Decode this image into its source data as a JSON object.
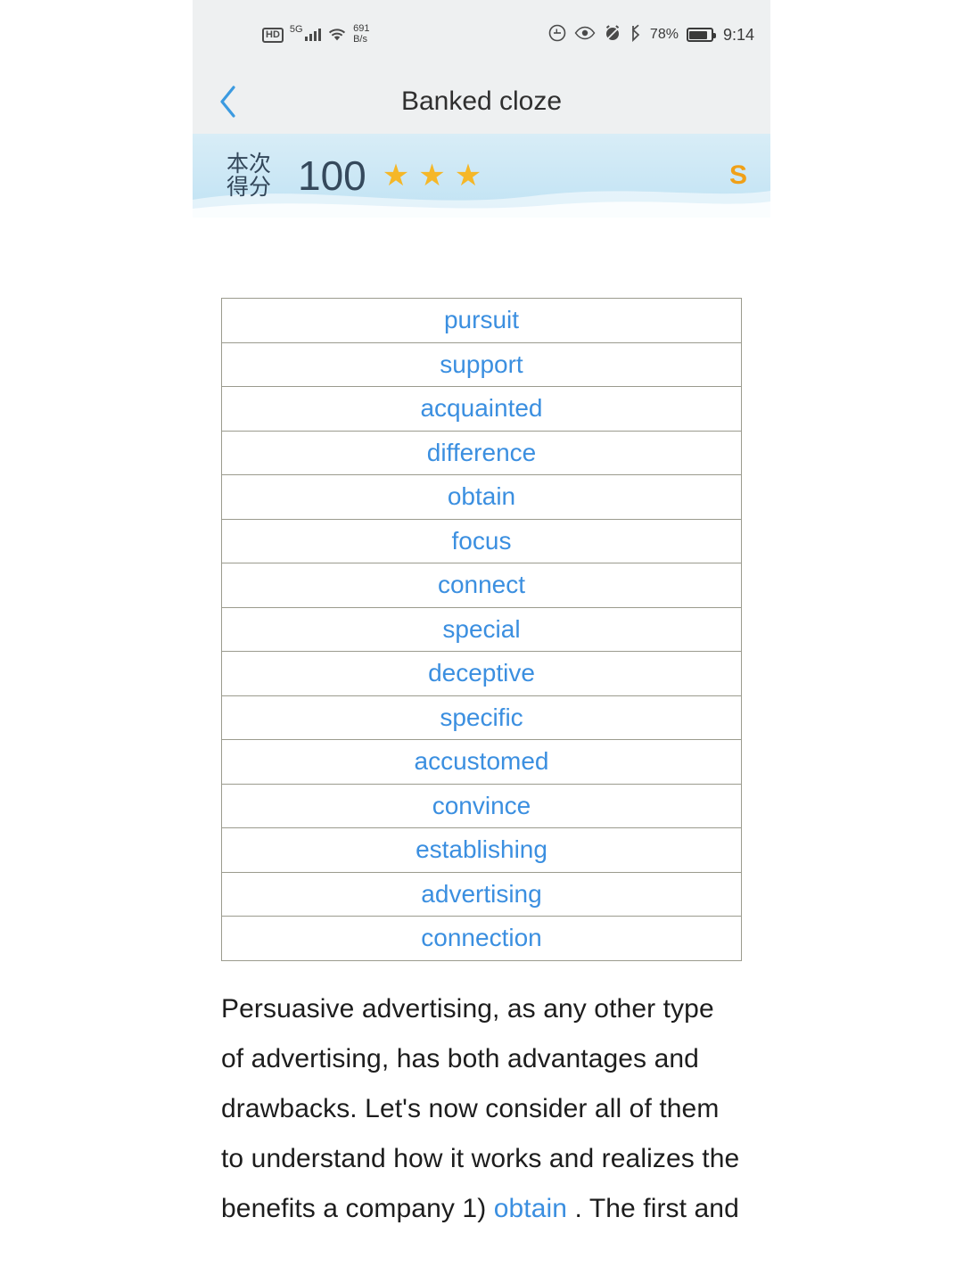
{
  "status_bar": {
    "hd_label": "HD",
    "network_type": "5G",
    "net_rate_value": "691",
    "net_rate_unit": "B/s",
    "battery_percent": "78%",
    "clock": "9:14",
    "icons": [
      "hd-icon",
      "signal-icon",
      "wifi-icon",
      "do-not-disturb-icon",
      "eye-care-icon",
      "alarm-mute-icon",
      "bluetooth-icon",
      "battery-icon"
    ]
  },
  "title_bar": {
    "back_icon": "chevron-left-icon",
    "title": "Banked cloze"
  },
  "score_banner": {
    "label": "本次得分",
    "score": "100",
    "stars": [
      "★",
      "★",
      "★"
    ],
    "star_color": "#f5b728",
    "share_label": "S",
    "share_color": "#f0a017"
  },
  "word_bank": {
    "words": [
      "pursuit",
      "support",
      "acquainted",
      "difference",
      "obtain",
      "focus",
      "connect",
      "special",
      "deceptive",
      "specific",
      "accustomed",
      "convince",
      "establishing",
      "advertising",
      "connection"
    ],
    "word_color": "#3b8fe0"
  },
  "passage": {
    "text": "Persuasive advertising, as any other type of advertising, has both advantages and drawbacks. Let's now consider all of them to understand how it works and realizes the benefits a company",
    "next_line_number": "1)",
    "next_line_word": "obtain",
    "next_line_tail": ". The first and"
  }
}
